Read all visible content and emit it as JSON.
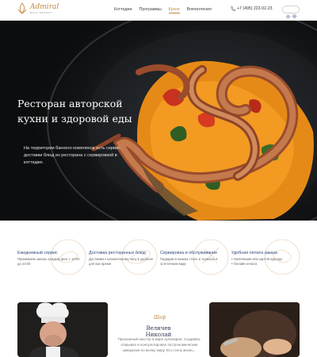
{
  "logo": {
    "name": "Admiral",
    "sub": "BATH RESORT"
  },
  "nav": [
    {
      "label": "Коттеджи",
      "active": false
    },
    {
      "label": "Программы",
      "active": false
    },
    {
      "label": "Кухня",
      "active": true
    },
    {
      "label": "Впечатления",
      "active": false
    }
  ],
  "phone": "+7 (495) 222-02-23",
  "icons": {
    "phone": "phone-icon",
    "theme_toggle": "theme-toggle-icon",
    "logo": "logo-lotus-icon",
    "service_deco": "ornament-icon"
  },
  "colors": {
    "accent": "#c0873c",
    "service_title": "#2f4a7a",
    "hero_bg": "#1a1c1e"
  },
  "hero": {
    "title": "Ресторан авторской кухни и здоровой еды",
    "text": "На территории банного комплекса есть сервис доставки блюд из ресторана с сервировкой в коттедже."
  },
  "services": [
    {
      "title": "Ежедневный сервис",
      "text": "Принимаем заказы каждый день с 10:00 до 23:00"
    },
    {
      "title": "Доставка ресторанных блюд",
      "text": "Доставим к назначенному часу в удобное для вас время"
    },
    {
      "title": "Сервировка и обслуживание",
      "text": "Подадим в вашем стиле и термосы в эстетичном виде"
    },
    {
      "title": "Удобная оплата заказа",
      "text": "• Наличными или картой курьеру\n• Онлайн-оплата"
    }
  ],
  "chef": {
    "label": "Шеф",
    "name": "Величев Николай",
    "text": "Признанный мастер в мире кулинарии. Создавал, открывал и консультировал гастрономические заведения по всему миру. Его стиль жизнь..."
  }
}
